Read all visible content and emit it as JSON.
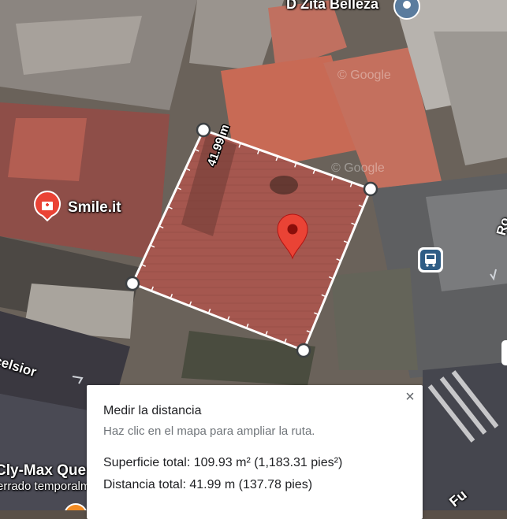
{
  "map": {
    "place_labels": {
      "business_top": "D Zita Belleza",
      "business_left": "Smile.it",
      "business_bottom_left": "Cly-Max Ques",
      "business_bottom_left_sub": "errado temporalm",
      "street_left": "celsior",
      "street_right": "Ro",
      "street_bottom_right": "Fu"
    },
    "watermarks": [
      "© Google",
      "© Google"
    ],
    "measurement": {
      "side_label": "41.99 m",
      "line_color": "#ffffff",
      "vertex_fill": "#ffffff",
      "vertex_stroke": "#3c4043"
    },
    "markers": {
      "selected_pin_color": "#ea4335",
      "poi_health_color": "#ea4335",
      "transit_icon_color": "#1a73e8"
    },
    "icons": [
      "location-pin-icon",
      "health-poi-icon",
      "bus-stop-icon",
      "close-icon",
      "direction-arrow-icon"
    ]
  },
  "panel": {
    "title": "Medir la distancia",
    "hint": "Haz clic en el mapa para ampliar la ruta.",
    "area_text": "Superficie total: 109.93 m² (1,183.31 pies²)",
    "distance_text": "Distancia total: 41.99 m (137.78 pies)",
    "close_label": "×"
  }
}
